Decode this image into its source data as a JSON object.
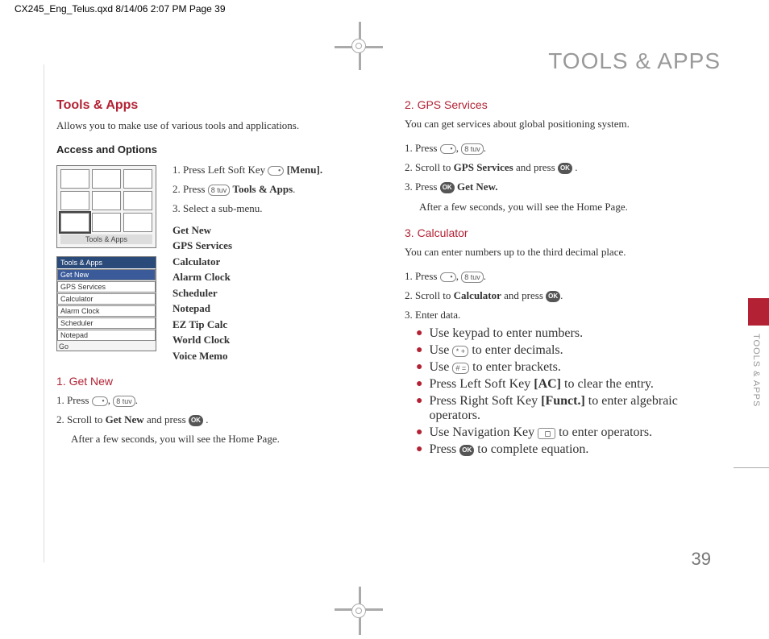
{
  "slug": "CX245_Eng_Telus.qxd  8/14/06  2:07 PM  Page 39",
  "main_title": "TOOLS & APPS",
  "page_num": "39",
  "side_tab": "TOOLS & APPS",
  "col1": {
    "h2": "Tools & Apps",
    "intro": "Allows you to make use of various tools and applications.",
    "access_h": "Access and Options",
    "step1_a": "1. Press Left Soft Key ",
    "step1_b": " [Menu].",
    "step2_a": "2. Press ",
    "step2_b": " Tools & Apps.",
    "step2_bold": "Tools & Apps",
    "step3": "3. Select a sub-menu.",
    "submenu": [
      "Get New",
      "GPS Services",
      "Calculator",
      "Alarm Clock",
      "Scheduler",
      "Notepad",
      "EZ Tip Calc",
      "World Clock",
      "Voice Memo"
    ],
    "screen1_label": "Tools & Apps",
    "screen2_head": "Tools & Apps",
    "screen2_items": [
      "Get New",
      "GPS Services",
      "Calculator",
      "Alarm Clock",
      "Scheduler",
      "Notepad"
    ],
    "screen2_foot": "Go",
    "getnew_h": "1. Get New",
    "gn_s1_a": "1. Press ",
    "gn_s1_b": ", ",
    "gn_s1_c": ".",
    "gn_s2_a": "2. Scroll to ",
    "gn_s2_bold": "Get New",
    "gn_s2_b": " and press ",
    "gn_s2_c": " .",
    "gn_s2_note": "After a few seconds, you will see the Home Page."
  },
  "col2": {
    "gps_h": "2. GPS Services",
    "gps_intro": "You can get services about global positioning system.",
    "gps_s1_a": "1. Press ",
    "gps_s1_b": ", ",
    "gps_s1_c": ".",
    "gps_s2_a": "2. Scroll to ",
    "gps_s2_bold": "GPS Services",
    "gps_s2_b": " and press ",
    "gps_s2_c": " .",
    "gps_s3_a": "3. Press ",
    "gps_s3_bold": " Get New.",
    "gps_s3_note": "After a few seconds, you will see the Home Page.",
    "calc_h": "3. Calculator",
    "calc_intro": "You can enter numbers up to the third decimal place.",
    "calc_s1_a": "1. Press ",
    "calc_s1_b": ", ",
    "calc_s1_c": ".",
    "calc_s2_a": "2. Scroll to ",
    "calc_s2_bold": "Calculator",
    "calc_s2_b": " and press ",
    "calc_s2_c": ".",
    "calc_s3": "3. Enter data.",
    "calc_b1": "Use keypad to enter numbers.",
    "calc_b2_a": "Use ",
    "calc_b2_b": " to enter decimals.",
    "calc_b3_a": "Use ",
    "calc_b3_b": " to enter brackets.",
    "calc_b4_a": "Press Left Soft Key ",
    "calc_b4_bold": "[AC]",
    "calc_b4_b": " to clear the entry.",
    "calc_b5_a": "Press Right Soft Key ",
    "calc_b5_bold": "[Funct.]",
    "calc_b5_b": " to enter algebraic operators.",
    "calc_b6_a": "Use Navigation Key ",
    "calc_b6_b": " to enter operators.",
    "calc_b7_a": "Press ",
    "calc_b7_b": " to complete equation."
  },
  "keys": {
    "eight": "8 tuv",
    "ok": "OK",
    "star": "* +",
    "hash": "# ="
  }
}
